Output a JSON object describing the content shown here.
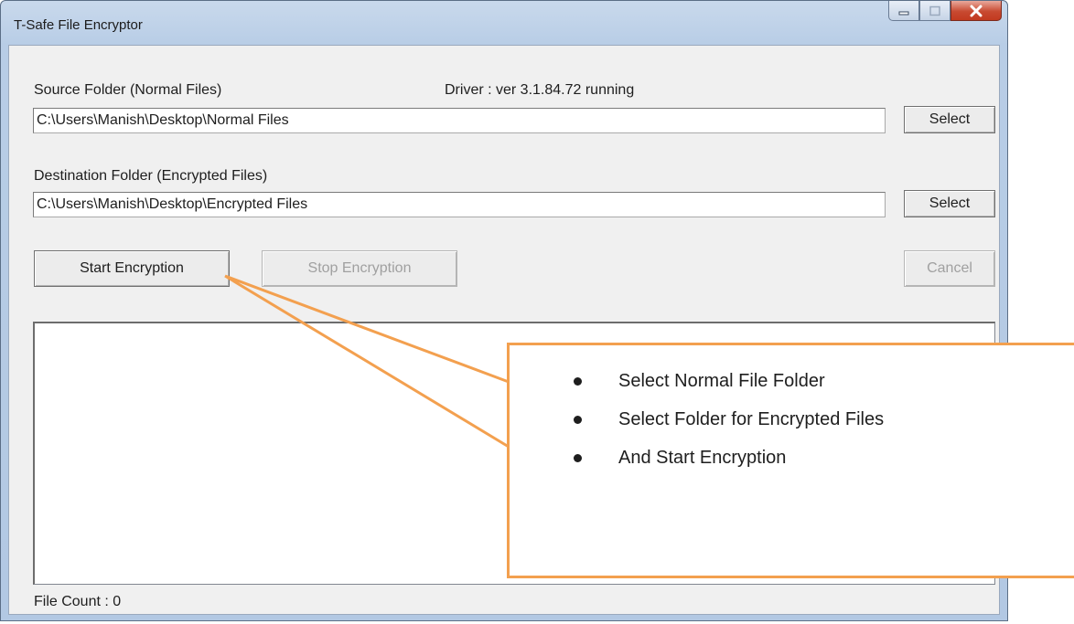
{
  "window": {
    "title": "T-Safe File Encryptor"
  },
  "source": {
    "label": "Source Folder (Normal Files)",
    "value": "C:\\Users\\Manish\\Desktop\\Normal Files",
    "select_label": "Select"
  },
  "driver_status": "Driver : ver 3.1.84.72 running",
  "destination": {
    "label": "Destination Folder (Encrypted Files)",
    "value": "C:\\Users\\Manish\\Desktop\\Encrypted Files",
    "select_label": "Select"
  },
  "actions": {
    "start_label": "Start Encryption",
    "stop_label": "Stop Encryption",
    "cancel_label": "Cancel"
  },
  "status": {
    "file_count": "File Count : 0"
  },
  "callout": {
    "items": [
      "Select Normal File Folder",
      "Select Folder for Encrypted Files",
      "And Start Encryption"
    ],
    "border_color": "#f3a04f"
  },
  "icons": [
    "minimize-icon",
    "maximize-icon",
    "close-icon"
  ]
}
